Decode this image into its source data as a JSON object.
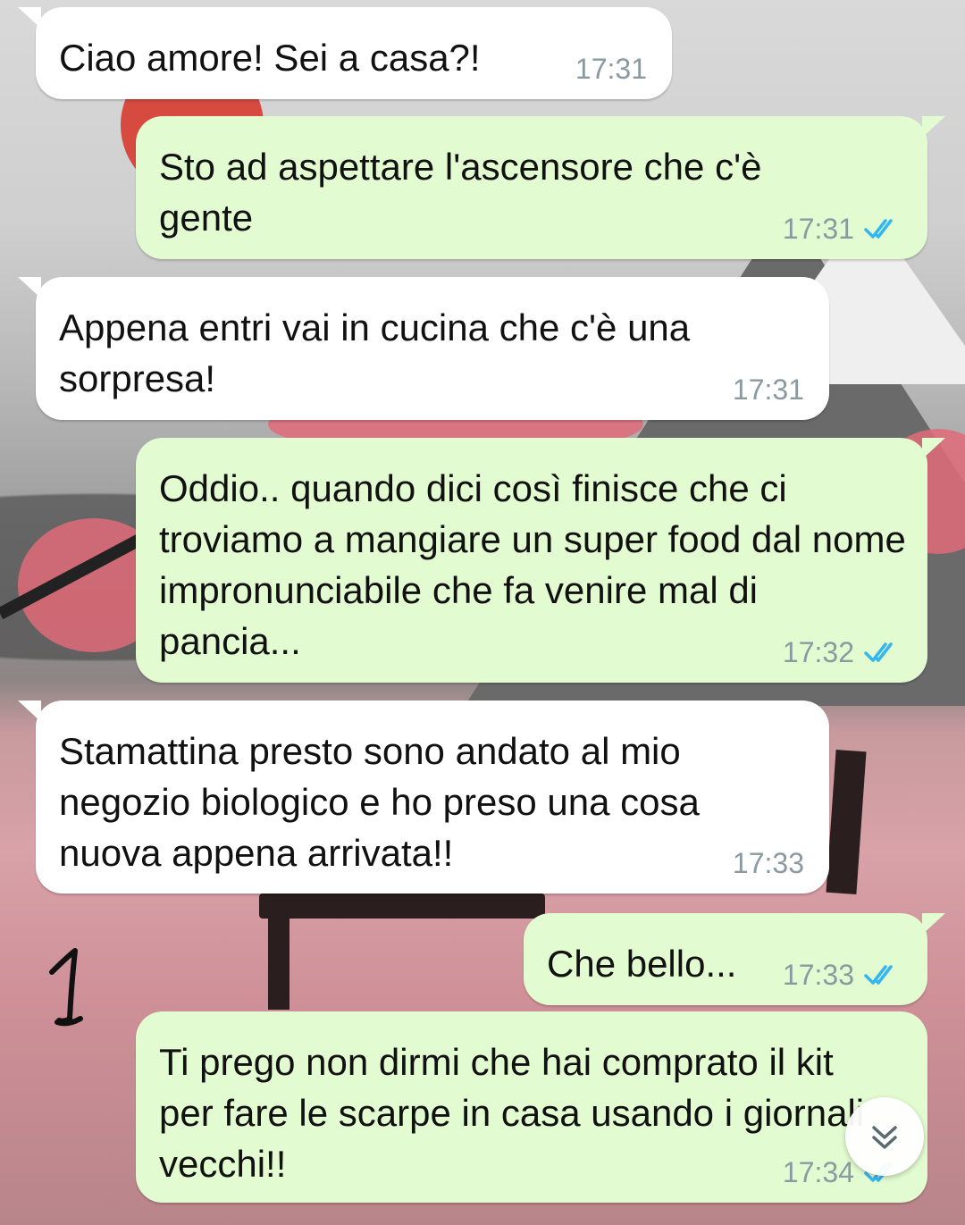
{
  "messages": [
    {
      "direction": "incoming",
      "text": "Ciao amore! Sei a casa?!",
      "time": "17:31"
    },
    {
      "direction": "outgoing",
      "text": "Sto ad aspettare l'ascensore che c'è gente",
      "time": "17:31",
      "status_icon": "double-check-icon"
    },
    {
      "direction": "incoming",
      "text": "Appena entri vai in cucina che c'è una sorpresa!",
      "time": "17:31"
    },
    {
      "direction": "outgoing",
      "text": "Oddio.. quando dici così finisce che ci troviamo a mangiare un super food dal nome impronunciabile che fa venire mal di pancia...",
      "time": "17:32",
      "status_icon": "double-check-icon"
    },
    {
      "direction": "incoming",
      "text": "Stamattina presto sono andato al mio negozio biologico e ho preso una cosa nuova appena arrivata!!",
      "time": "17:33"
    },
    {
      "direction": "outgoing",
      "text": "Che bello...",
      "time": "17:33",
      "status_icon": "double-check-icon"
    },
    {
      "direction": "outgoing",
      "text": "Ti prego non dirmi che hai comprato il kit per fare le scarpe in casa usando i giornali vecchi!!",
      "time": "17:34",
      "status_icon": "double-check-icon"
    }
  ],
  "annotation": "1",
  "colors": {
    "incoming_bubble": "#ffffff",
    "outgoing_bubble": "#e2fbd0",
    "read_tick": "#34b7f1",
    "timestamp": "#8a9aa0"
  },
  "scroll_button_icon": "double-chevron-down-icon"
}
